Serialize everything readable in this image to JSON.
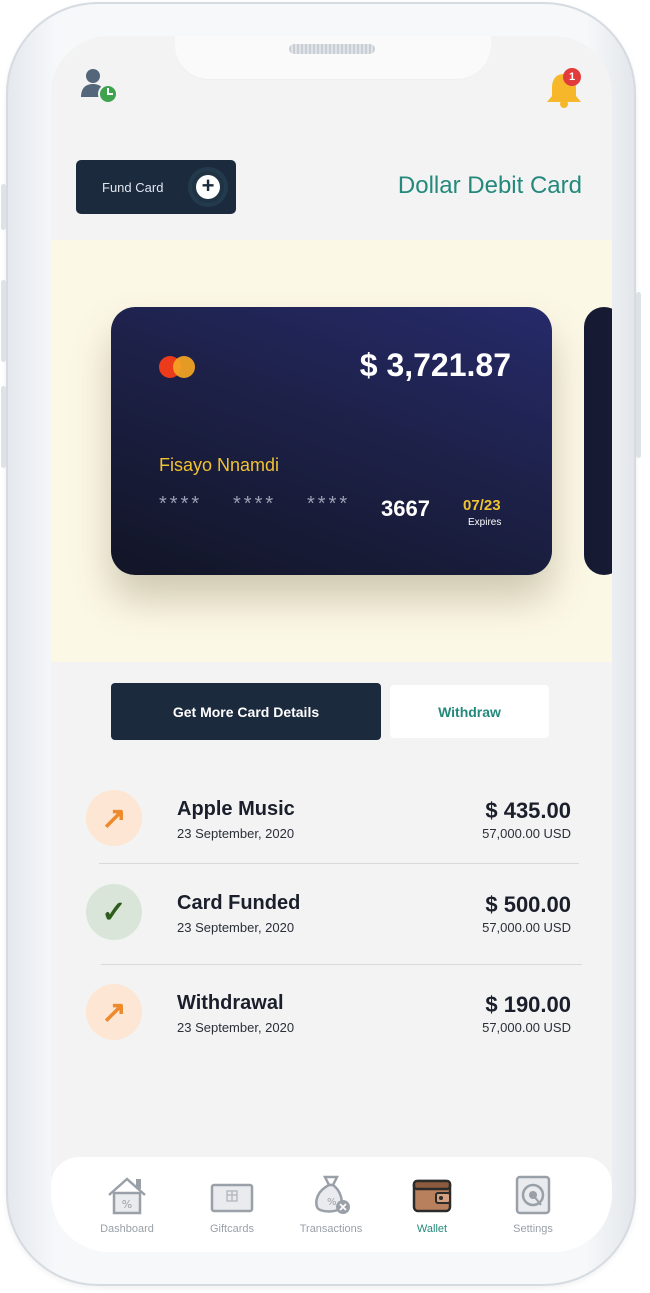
{
  "header": {
    "notification_count": "1",
    "fund_card_label": "Fund Card",
    "title": "Dollar Debit Card"
  },
  "card": {
    "balance": "$ 3,721.87",
    "holder": "Fisayo Nnamdi",
    "mask_groups": [
      "****",
      "****",
      "****"
    ],
    "last4": "3667",
    "expiry": "07/23",
    "expiry_label": "Expires",
    "brand_icon": "mastercard-logo"
  },
  "actions": {
    "details_label": "Get More Card Details",
    "withdraw_label": "Withdraw"
  },
  "transactions": [
    {
      "name": "Apple Music",
      "date": "23 September, 2020",
      "amount": "$ 435.00",
      "usd": "57,000.00 USD",
      "direction": "out",
      "icon": "arrow-up-right-icon"
    },
    {
      "name": "Card Funded",
      "date": "23 September, 2020",
      "amount": "$ 500.00",
      "usd": "57,000.00 USD",
      "direction": "in",
      "icon": "check-icon"
    },
    {
      "name": "Withdrawal",
      "date": "23 September, 2020",
      "amount": "$ 190.00",
      "usd": "57,000.00 USD",
      "direction": "out",
      "icon": "arrow-up-right-icon"
    }
  ],
  "nav": [
    {
      "label": "Dashboard",
      "icon": "house-icon",
      "active": false
    },
    {
      "label": "Giftcards",
      "icon": "giftcard-icon",
      "active": false
    },
    {
      "label": "Transactions",
      "icon": "money-bag-icon",
      "active": false
    },
    {
      "label": "Wallet",
      "icon": "wallet-icon",
      "active": true
    },
    {
      "label": "Settings",
      "icon": "settings-icon",
      "active": false
    }
  ],
  "colors": {
    "accent": "#24897c",
    "dark": "#1c2a3e",
    "card_yellow": "#f1c232",
    "band": "#fcf8e6",
    "badge": "#e23b3b"
  }
}
